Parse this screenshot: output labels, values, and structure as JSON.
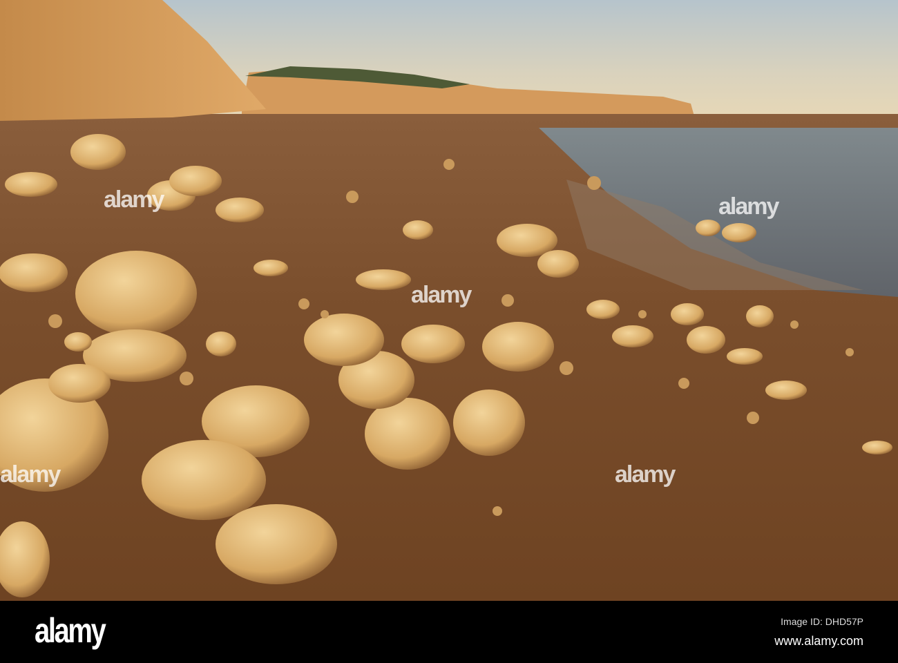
{
  "watermark": {
    "text": "alamy"
  },
  "footer": {
    "logo": "alamy",
    "image_id": "Image ID: DHD57P",
    "url": "www.alamy.com"
  }
}
